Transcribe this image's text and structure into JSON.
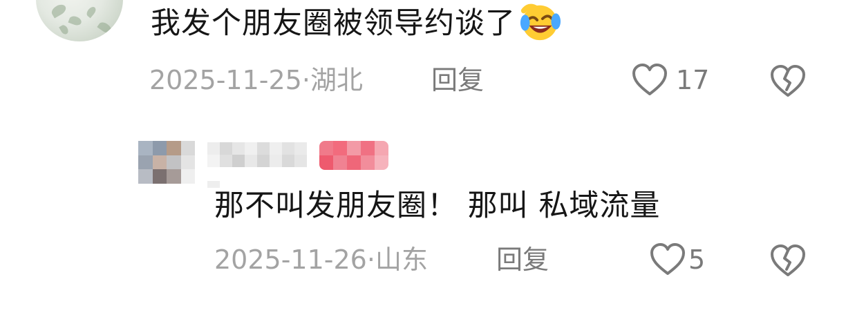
{
  "comment": {
    "text": "我发个朋友圈被领导约谈了",
    "emoji": "rofl-emoji",
    "date": "2025-11-25",
    "separator": "·",
    "location": "湖北",
    "reply_label": "回复",
    "like_count": "17"
  },
  "reply": {
    "text": "那不叫发朋友圈！ 那叫 私域流量",
    "date": "2025-11-26",
    "separator": "·",
    "location": "山东",
    "reply_label": "回复",
    "like_count": "5"
  },
  "colors": {
    "text": "#161616",
    "meta": "#a3a3a3",
    "action": "#7a7a7a",
    "badge": "#ee5a6e"
  }
}
